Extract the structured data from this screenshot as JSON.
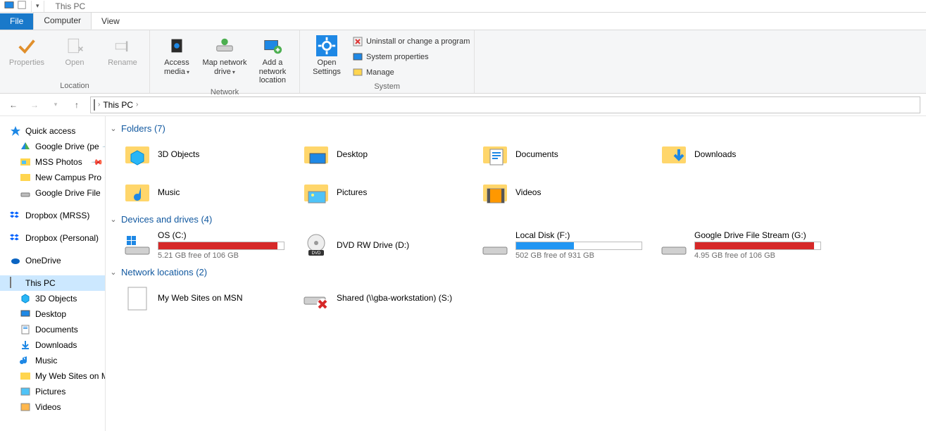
{
  "window": {
    "title": "This PC"
  },
  "tabs": {
    "file": "File",
    "computer": "Computer",
    "view": "View"
  },
  "ribbon": {
    "location": {
      "label": "Location",
      "properties": "Properties",
      "open": "Open",
      "rename": "Rename"
    },
    "network": {
      "label": "Network",
      "access_media": "Access media",
      "map_drive": "Map network drive",
      "add_location": "Add a network location"
    },
    "system": {
      "label": "System",
      "open_settings": "Open Settings",
      "uninstall": "Uninstall or change a program",
      "sys_props": "System properties",
      "manage": "Manage"
    }
  },
  "breadcrumb": {
    "root": "This PC"
  },
  "sidebar": {
    "quick_access": "Quick access",
    "qa_items": [
      {
        "label": "Google Drive (pe",
        "pin": true,
        "icon": "gdrive"
      },
      {
        "label": "MSS Photos",
        "pin": true,
        "icon": "photos"
      },
      {
        "label": "New Campus Pro",
        "pin": true,
        "icon": "folder"
      },
      {
        "label": "Google Drive File",
        "pin": false,
        "icon": "drive"
      }
    ],
    "dropbox_mrss": "Dropbox (MRSS)",
    "dropbox_personal": "Dropbox (Personal)",
    "onedrive": "OneDrive",
    "this_pc": "This PC",
    "pc_children": [
      {
        "label": "3D Objects",
        "icon": "3d"
      },
      {
        "label": "Desktop",
        "icon": "desktop"
      },
      {
        "label": "Documents",
        "icon": "documents"
      },
      {
        "label": "Downloads",
        "icon": "downloads"
      },
      {
        "label": "Music",
        "icon": "music"
      },
      {
        "label": "My Web Sites on M",
        "icon": "web"
      },
      {
        "label": "Pictures",
        "icon": "pictures"
      },
      {
        "label": "Videos",
        "icon": "videos"
      }
    ]
  },
  "groups": {
    "folders": {
      "title": "Folders (7)",
      "items": [
        {
          "name": "3D Objects"
        },
        {
          "name": "Desktop"
        },
        {
          "name": "Documents"
        },
        {
          "name": "Downloads"
        },
        {
          "name": "Music"
        },
        {
          "name": "Pictures"
        },
        {
          "name": "Videos"
        }
      ]
    },
    "drives": {
      "title": "Devices and drives (4)",
      "items": [
        {
          "name": "OS (C:)",
          "free": "5.21 GB free of 106 GB",
          "fill": 95,
          "color": "red"
        },
        {
          "name": "DVD RW Drive (D:)",
          "free": "",
          "fill": 0,
          "color": ""
        },
        {
          "name": "Local Disk (F:)",
          "free": "502 GB free of 931 GB",
          "fill": 46,
          "color": "blue"
        },
        {
          "name": "Google Drive File Stream (G:)",
          "free": "4.95 GB free of 106 GB",
          "fill": 95,
          "color": "red"
        }
      ]
    },
    "network": {
      "title": "Network locations (2)",
      "items": [
        {
          "name": "My Web Sites on MSN"
        },
        {
          "name": "Shared (\\\\gba-workstation) (S:)"
        }
      ]
    }
  }
}
